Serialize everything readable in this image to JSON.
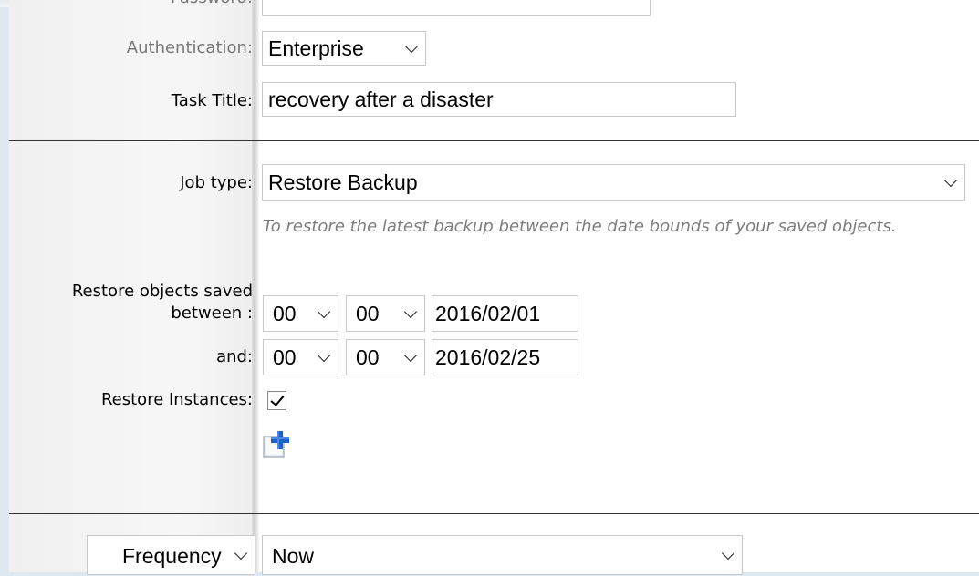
{
  "form": {
    "password_label": "Password:",
    "authentication_label": "Authentication:",
    "authentication_value": "Enterprise",
    "task_title_label": "Task Title:",
    "task_title_value": "recovery after a disaster",
    "job_type_label": "Job type:",
    "job_type_value": "Restore Backup",
    "job_hint": "To restore the latest backup between the date bounds of your saved objects.",
    "restore_between_label_line1": "Restore objects saved",
    "restore_between_label_line2": "between :",
    "start_hour": "00",
    "start_minute": "00",
    "start_date": "2016/02/01",
    "and_label": "and:",
    "end_hour": "00",
    "end_minute": "00",
    "end_date": "2016/02/25",
    "restore_instances_label": "Restore Instances:",
    "restore_instances_checked": true,
    "frequency_label": "Frequency",
    "frequency_value": "Now"
  },
  "icons": {
    "add": "plus-icon",
    "dropdown": "chevron-down-icon",
    "check": "check-icon"
  },
  "colors": {
    "label_gray": "#777777",
    "hint_gray": "#7d7d7d",
    "divider": "#333333"
  }
}
